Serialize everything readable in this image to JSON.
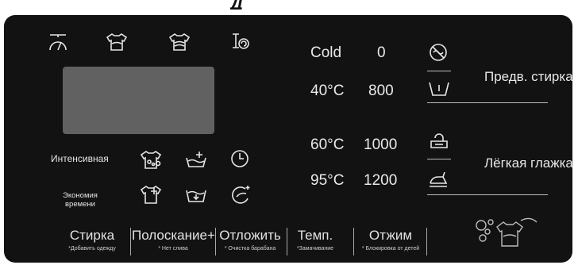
{
  "header": {
    "partial_title": "Д"
  },
  "left_labels": {
    "intensive": "Интенсивная",
    "economy_time": "Экономия времени"
  },
  "temperatures": [
    "Cold",
    "40°C",
    "60°C",
    "95°C"
  ],
  "spins": [
    "0",
    "800",
    "1000",
    "1200"
  ],
  "right_labels": {
    "prewash": "Предв. стирка",
    "easy_iron": "Лёгкая глажка"
  },
  "buttons": [
    {
      "label": "Стирка",
      "sub": "*Добавить одежду"
    },
    {
      "label": "Полоскание+",
      "sub": "* Нет слива"
    },
    {
      "label": "Отложить",
      "sub": "* Очистка барабана"
    },
    {
      "label": "Темп.",
      "sub": "*Замачивание"
    },
    {
      "label": "Отжим",
      "sub": "* Блокировка от детей"
    }
  ],
  "icons": [
    "scale-icon",
    "shirt-icon",
    "shirt-double-icon",
    "drum-clean-icon",
    "intensive-wash-icon",
    "rinse-plus-icon",
    "clock-icon",
    "shirt-plus-icon",
    "tub-drain-icon",
    "eco-leaf-icon",
    "no-spin-icon",
    "prewash-tub-icon",
    "soak-icon",
    "iron-icon",
    "laundry-bubbles-icon"
  ],
  "colors": {
    "panel": "#121212",
    "display": "#616161",
    "text": "#e6e6e6"
  }
}
